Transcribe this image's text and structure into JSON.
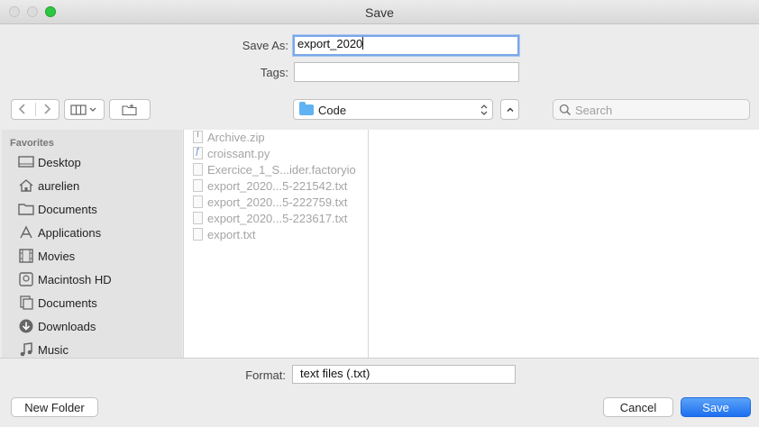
{
  "window": {
    "title": "Save"
  },
  "save_as": {
    "label": "Save As:",
    "value": "export_2020"
  },
  "tags": {
    "label": "Tags:",
    "value": ""
  },
  "location": {
    "folder": "Code"
  },
  "search": {
    "placeholder": "Search"
  },
  "sidebar": {
    "heading": "Favorites",
    "items": [
      {
        "label": "Desktop",
        "icon": "desktop-icon"
      },
      {
        "label": "aurelien",
        "icon": "home-icon"
      },
      {
        "label": "Documents",
        "icon": "folder-icon"
      },
      {
        "label": "Applications",
        "icon": "applications-icon"
      },
      {
        "label": "Movies",
        "icon": "film-icon"
      },
      {
        "label": "Macintosh HD",
        "icon": "disk-icon"
      },
      {
        "label": "Documents",
        "icon": "document-icon"
      },
      {
        "label": "Downloads",
        "icon": "download-icon"
      },
      {
        "label": "Music",
        "icon": "music-icon"
      }
    ]
  },
  "files": [
    {
      "name": "Archive.zip",
      "icon": "zip-icon"
    },
    {
      "name": "croissant.py",
      "icon": "python-file-icon"
    },
    {
      "name": "Exercice_1_S...ider.factoryio",
      "icon": "file-icon"
    },
    {
      "name": "export_2020...5-221542.txt",
      "icon": "text-file-icon"
    },
    {
      "name": "export_2020...5-222759.txt",
      "icon": "text-file-icon"
    },
    {
      "name": "export_2020...5-223617.txt",
      "icon": "text-file-icon"
    },
    {
      "name": "export.txt",
      "icon": "text-file-icon"
    }
  ],
  "format": {
    "label": "Format:",
    "value": "text files (.txt)"
  },
  "buttons": {
    "new_folder": "New Folder",
    "cancel": "Cancel",
    "save": "Save"
  }
}
